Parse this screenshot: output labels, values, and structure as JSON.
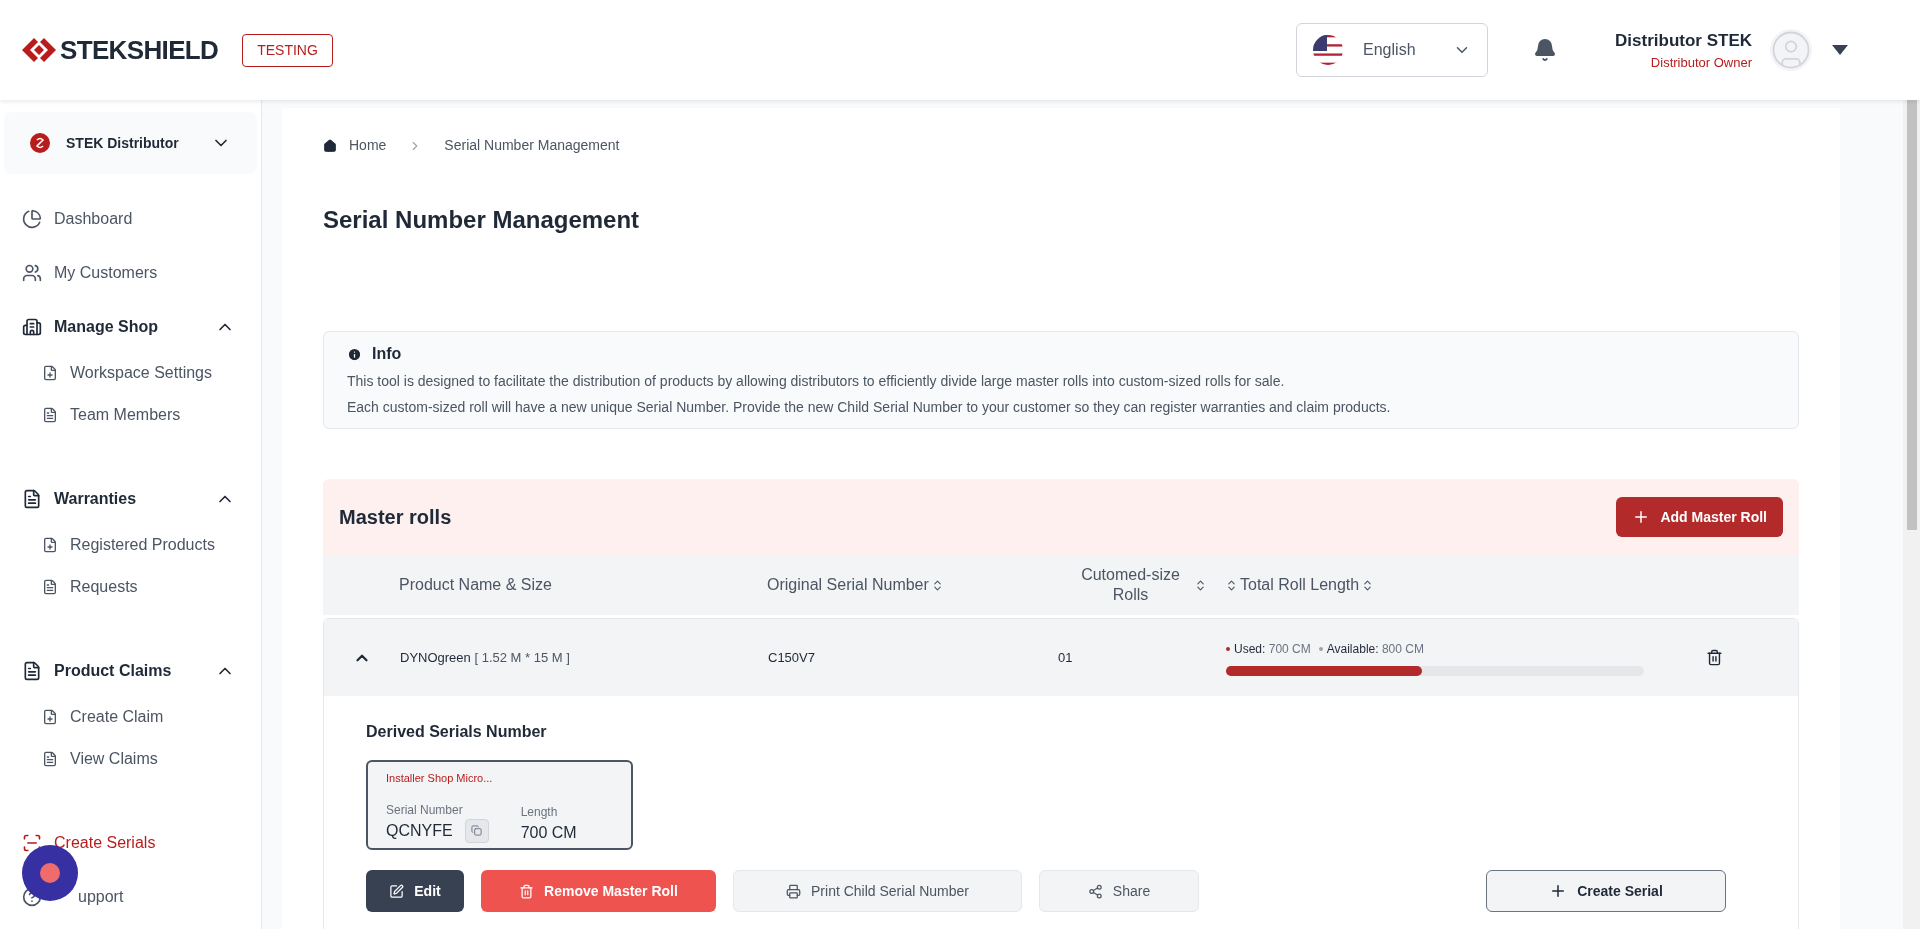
{
  "header": {
    "brand": "STEKSHIELD",
    "env_badge": "TESTING",
    "language": "English",
    "user_name": "Distributor STEK",
    "user_role": "Distributor Owner"
  },
  "sidebar": {
    "workspace": "STEK Distributor",
    "items": [
      {
        "kind": "link",
        "label": "Dashboard",
        "selected": false
      },
      {
        "kind": "link",
        "label": "My Customers",
        "selected": false
      },
      {
        "kind": "group",
        "label": "Manage Shop",
        "expanded": true,
        "children": [
          {
            "label": "Workspace Settings",
            "selected": false
          },
          {
            "label": "Team Members",
            "selected": false
          }
        ]
      },
      {
        "kind": "group",
        "label": "Warranties",
        "expanded": true,
        "children": [
          {
            "label": "Registered Products",
            "selected": false
          },
          {
            "label": "Requests",
            "selected": false
          }
        ]
      },
      {
        "kind": "group",
        "label": "Product Claims",
        "expanded": true,
        "children": [
          {
            "label": "Create Claim",
            "selected": false
          },
          {
            "label": "View Claims",
            "selected": false
          }
        ]
      },
      {
        "kind": "link",
        "label": "Create Serials",
        "selected": true
      },
      {
        "kind": "link",
        "label": "upport",
        "selected": false
      }
    ]
  },
  "breadcrumb": [
    "Home",
    "Serial Number Management"
  ],
  "page_title": "Serial Number Management",
  "info": {
    "title": "Info",
    "lines": [
      "This tool is designed to facilitate the distribution of products by allowing distributors to efficiently divide large master rolls into custom-sized rolls for sale.",
      "Each custom-sized roll will have a new unique Serial Number. Provide the new Child Serial Number to your customer so they can register warranties and claim products."
    ]
  },
  "master_rolls": {
    "title": "Master rolls",
    "add_button": "Add Master Roll",
    "columns": [
      {
        "label": "Product Name & Size",
        "sortable": false
      },
      {
        "label": "Original Serial Number",
        "sortable": true
      },
      {
        "label": "Cutomed-size Rolls",
        "sortable": true
      },
      {
        "label": "Total Roll Length",
        "sortable": true
      }
    ],
    "rows": [
      {
        "expanded": true,
        "product": "DYNOgreen",
        "size": "[ 1.52 M * 15 M ]",
        "serial": "C150V7",
        "rolls": "01",
        "used_label": "Used:",
        "used": "700 CM",
        "available_label": "Available:",
        "available": "800 CM",
        "level": 0.47,
        "derived_title": "Derived Serials Number",
        "derived": [
          {
            "owner": "Installer Shop Micro...",
            "serial_label": "Serial Number",
            "serial": "QCNYFE",
            "length_label": "Length",
            "length": "700 CM"
          }
        ],
        "actions": [
          {
            "kind": "edit",
            "label": "Edit"
          },
          {
            "kind": "remove",
            "label": "Remove Master Roll"
          },
          {
            "kind": "print",
            "label": "Print Child Serial Number"
          },
          {
            "kind": "share",
            "label": "Share"
          },
          {
            "kind": "create",
            "label": "Create Serial"
          }
        ]
      }
    ]
  }
}
